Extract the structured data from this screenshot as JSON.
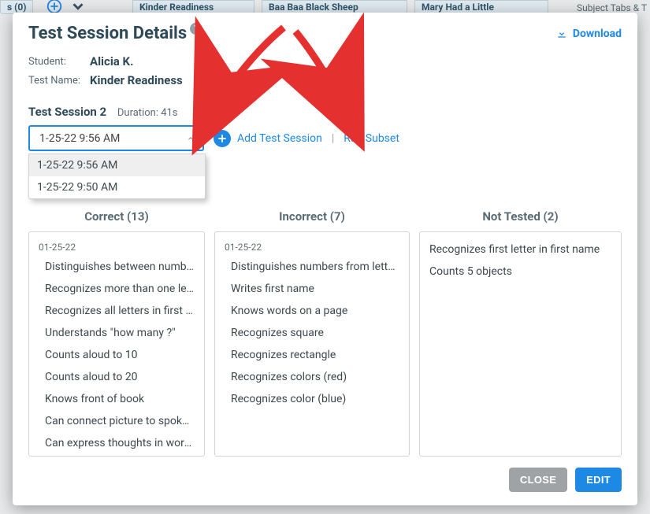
{
  "colors": {
    "accent": "#1e88e5",
    "arrow": "#e53030"
  },
  "backdrop": {
    "tab_left_label": "s (0)",
    "tab1": "Kinder Readiness",
    "tab2": "Baa Baa Black Sheep",
    "tab3": "Mary Had a Little",
    "right_label": "Subject Tabs & T"
  },
  "modal": {
    "title": "Test Session Details",
    "download_label": "Download",
    "meta": {
      "student_label": "Student:",
      "student_value": "Alicia K.",
      "testname_label": "Test Name:",
      "testname_value": "Kinder Readiness"
    },
    "session": {
      "header": "Test Session 2",
      "duration": "Duration: 41s",
      "dropdown_value": "1-25-22 9:56 AM",
      "options": [
        "1-25-22 9:56 AM",
        "1-25-22 9:50 AM"
      ],
      "add_label": "Add Test Session",
      "run_subset": "Run Subset"
    },
    "columns": {
      "correct": {
        "title": "Correct (13)",
        "date": "01-25-22",
        "items": [
          "Distinguishes between numbers",
          "Recognizes more than one letter",
          "Recognizes all letters in first name",
          "Understands \"how many ?\"",
          "Counts aloud to 10",
          "Counts aloud to 20",
          "Knows front of book",
          "Can connect picture to spoken word",
          "Can express thoughts in words"
        ]
      },
      "incorrect": {
        "title": "Incorrect (7)",
        "date": "01-25-22",
        "items": [
          "Distinguishes numbers from letters",
          "Writes first name",
          "Knows words on a page",
          "Recognizes square",
          "Recognizes rectangle",
          "Recognizes colors (red)",
          "Recognizes color (blue)"
        ]
      },
      "not_tested": {
        "title": "Not Tested (2)",
        "items": [
          "Recognizes first letter in first name",
          "Counts 5 objects"
        ]
      }
    },
    "buttons": {
      "close": "CLOSE",
      "edit": "EDIT"
    }
  }
}
